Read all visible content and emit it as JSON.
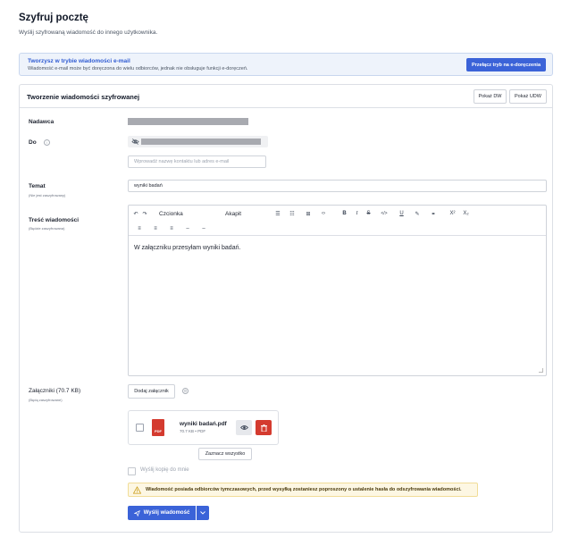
{
  "page": {
    "title": "Szyfruj pocztę",
    "subtitle": "Wyślij szyfrowaną wiadomość do innego użytkownika."
  },
  "banner": {
    "title": "Tworzysz w trybie wiadomości e-mail",
    "text": "Wiadomość e-mail może być doręczona do wielu odbiorców, jednak nie obsługuje funkcji e-doręczeń.",
    "button": "Przełącz tryb na e-doręczenia"
  },
  "card": {
    "title": "Tworzenie wiadomości szyfrowanej",
    "show_dw": "Pokaż DW",
    "show_udw": "Pokaż UDW"
  },
  "form": {
    "sender_label": "Nadawca",
    "to_label": "Do",
    "recipient_placeholder": "Wprowadź nazwę kontaktu lub adres e-mail",
    "subject_label": "Temat",
    "subject_note": "(Nie jest zaszyfrowany)",
    "subject_value": "wyniki badań",
    "body_label": "Treść wiadomości",
    "body_note": "(Będzie zaszyfrowana)",
    "body_text": "W załączniku przesyłam wyniki badań.",
    "attachments_label": "Załączniki (70.7 KB)",
    "attachments_note": "(Będą zaszyfrowane)",
    "add_attachment": "Dodaj załącznik",
    "select_all": "Zaznacz wszystko",
    "copy_to_me": "Wyślij kopię do mnie",
    "warning": "Wiadomość posiada odbiorców tymczasowych, przed wysyłką zostaniesz poproszony o ustalenie hasła do odszyfrowania wiadomości.",
    "send": "Wyślij wiadomość"
  },
  "toolbar": {
    "font": "Czcionka",
    "paragraph": "Akapit",
    "bold": "B",
    "italic": "I",
    "strike": "S",
    "code": "</>",
    "underline": "U",
    "sup": "X²",
    "sub": "X₂"
  },
  "file": {
    "name": "wyniki badań.pdf",
    "meta": "70.7 KB • PDF",
    "type_badge": "PDF"
  },
  "colors": {
    "primary": "#3b63d8",
    "danger": "#d43b2f",
    "warning_bg": "#fdf7e3"
  }
}
